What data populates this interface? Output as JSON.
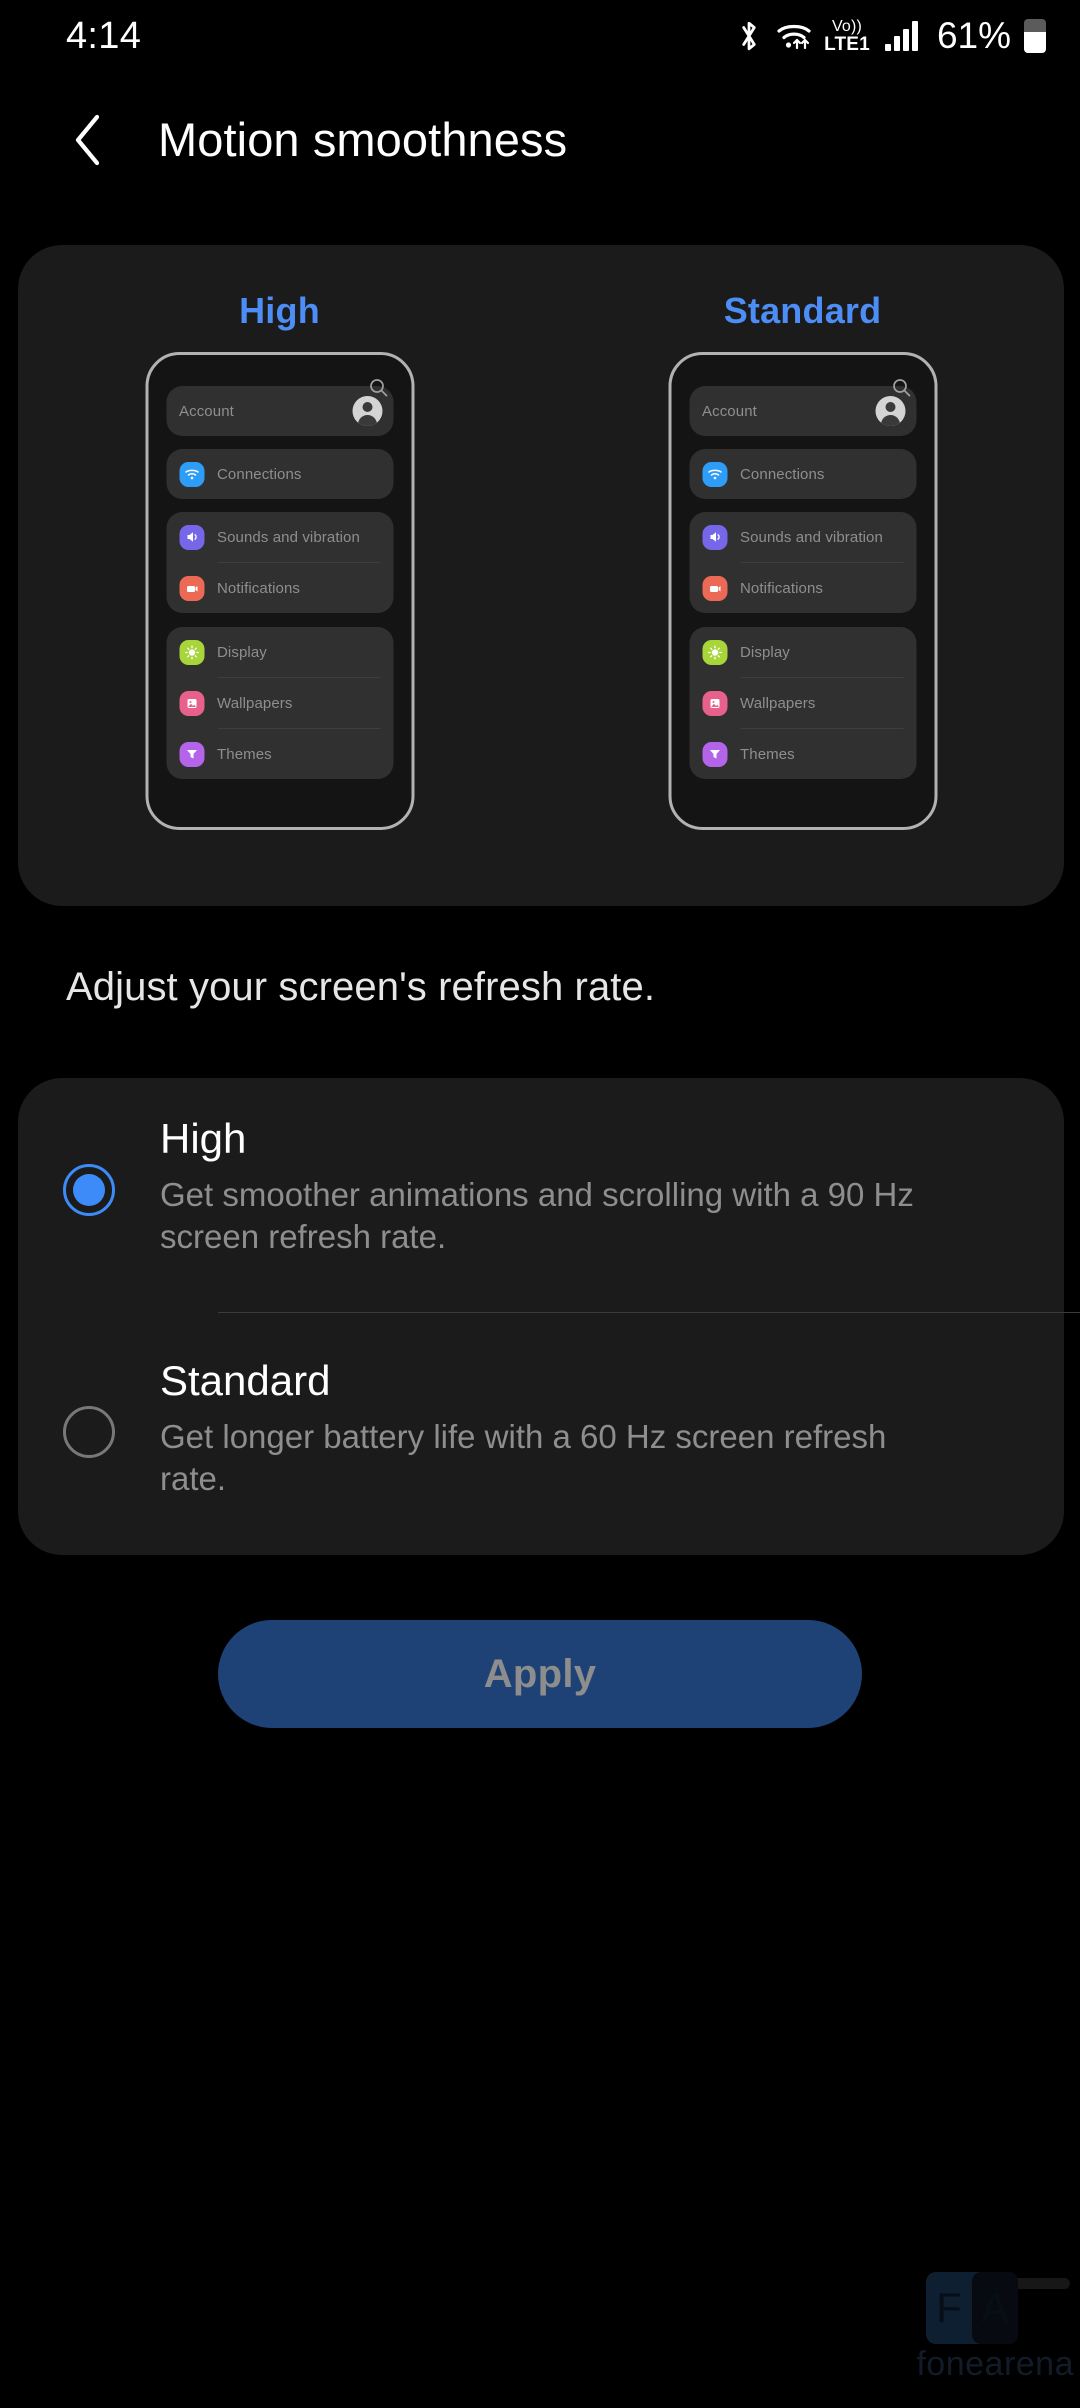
{
  "status_bar": {
    "time": "4:14",
    "battery_percent": "61%",
    "battery_level": 61,
    "network_label_top": "Vo))",
    "network_label_bottom": "LTE1",
    "icons": [
      "bluetooth-icon",
      "wifi-icon",
      "volte-icon",
      "signal-bars-icon",
      "battery-icon"
    ]
  },
  "app_bar": {
    "title": "Motion smoothness",
    "back_icon": "chevron-left-icon"
  },
  "preview": {
    "columns": [
      {
        "label": "High",
        "label_color": "#4c8df6",
        "mock": {
          "search_icon": "search-icon",
          "account": {
            "label": "Account",
            "avatar": "avatar-icon"
          },
          "groups": [
            {
              "rows": [
                {
                  "label": "Connections",
                  "icon": "wifi-tile-icon",
                  "color": "#2e9df7"
                }
              ]
            },
            {
              "rows": [
                {
                  "label": "Sounds and vibration",
                  "icon": "speaker-tile-icon",
                  "color": "#7667e8"
                },
                {
                  "label": "Notifications",
                  "icon": "notification-tile-icon",
                  "color": "#ec6a55"
                }
              ]
            },
            {
              "rows": [
                {
                  "label": "Display",
                  "icon": "brightness-tile-icon",
                  "color": "#a8d63a"
                },
                {
                  "label": "Wallpapers",
                  "icon": "wallpaper-tile-icon",
                  "color": "#e8618c"
                },
                {
                  "label": "Themes",
                  "icon": "themes-tile-icon",
                  "color": "#b464e8"
                }
              ]
            }
          ]
        }
      },
      {
        "label": "Standard",
        "label_color": "#4c8df6",
        "mock": {
          "search_icon": "search-icon",
          "account": {
            "label": "Account",
            "avatar": "avatar-icon"
          },
          "groups": [
            {
              "rows": [
                {
                  "label": "Connections",
                  "icon": "wifi-tile-icon",
                  "color": "#2e9df7"
                }
              ]
            },
            {
              "rows": [
                {
                  "label": "Sounds and vibration",
                  "icon": "speaker-tile-icon",
                  "color": "#7667e8"
                },
                {
                  "label": "Notifications",
                  "icon": "notification-tile-icon",
                  "color": "#ec6a55"
                }
              ]
            },
            {
              "rows": [
                {
                  "label": "Display",
                  "icon": "brightness-tile-icon",
                  "color": "#a8d63a"
                },
                {
                  "label": "Wallpapers",
                  "icon": "wallpaper-tile-icon",
                  "color": "#e8618c"
                },
                {
                  "label": "Themes",
                  "icon": "themes-tile-icon",
                  "color": "#b464e8"
                }
              ]
            }
          ]
        }
      }
    ]
  },
  "section": {
    "description": "Adjust your screen's refresh rate."
  },
  "options": [
    {
      "title": "High",
      "subtitle": "Get smoother animations and scrolling with a 90 Hz screen refresh rate.",
      "selected": true
    },
    {
      "title": "Standard",
      "subtitle": "Get longer battery life with a 60 Hz screen refresh rate.",
      "selected": false
    }
  ],
  "apply_button": {
    "label": "Apply",
    "enabled": false,
    "fill_color": "#1f4276",
    "text_color": "#8d8d8d"
  },
  "watermark": {
    "logo_f": "F",
    "logo_a": "A",
    "text": "fonearena"
  },
  "theme": {
    "background": "#000000",
    "card_background": "#1b1b1b",
    "accent": "#3d8bf9",
    "primary_text": "#ffffff",
    "secondary_text": "#8e8e8e"
  }
}
